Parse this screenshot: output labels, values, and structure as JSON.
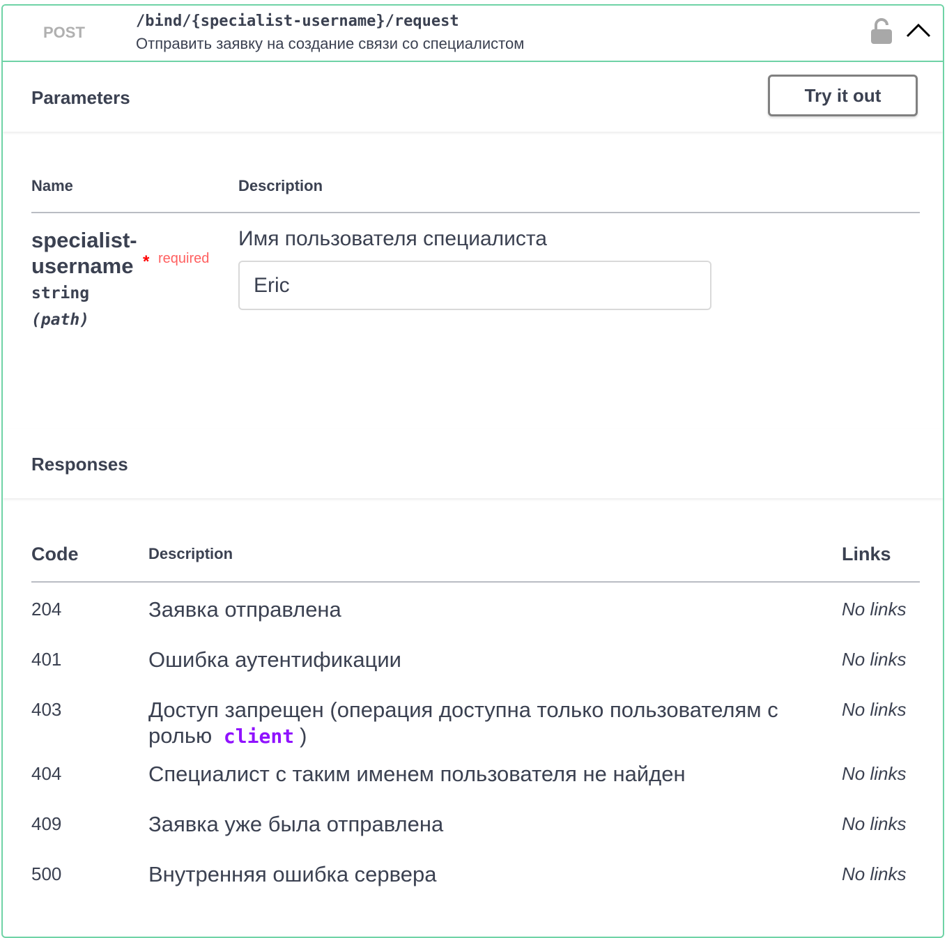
{
  "operation": {
    "method": "POST",
    "path": "/bind/{specialist-username}/request",
    "summary": "Отправить заявку на создание связи со специалистом",
    "lock_icon": "unlock-icon",
    "collapse_icon": "chevron-up-icon"
  },
  "parameters": {
    "title": "Parameters",
    "try_label": "Try it out",
    "col_name": "Name",
    "col_description": "Description",
    "items": [
      {
        "name_line1": "specialist-",
        "name_line2": "username",
        "required_star": "*",
        "required_text": "required",
        "type": "string",
        "in": "(path)",
        "description": "Имя пользователя специалиста",
        "value": "Eric"
      }
    ]
  },
  "responses": {
    "title": "Responses",
    "col_code": "Code",
    "col_description": "Description",
    "col_links": "Links",
    "rows": [
      {
        "code": "204",
        "description": "Заявка отправлена",
        "links": "No links"
      },
      {
        "code": "401",
        "description": "Ошибка аутентификации",
        "links": "No links"
      },
      {
        "code": "403",
        "description_before": "Доступ запрещен (операция доступна только пользователям с ролью",
        "description_code": "client",
        "description_after": ")",
        "links": "No links"
      },
      {
        "code": "404",
        "description": "Специалист с таким именем пользователя не найден",
        "links": "No links"
      },
      {
        "code": "409",
        "description": "Заявка уже была отправлена",
        "links": "No links"
      },
      {
        "code": "500",
        "description": "Внутренняя ошибка сервера",
        "links": "No links"
      }
    ]
  },
  "colors": {
    "border": "#49cc90",
    "required": "#ff0000",
    "inline_code": "#9012fe"
  }
}
